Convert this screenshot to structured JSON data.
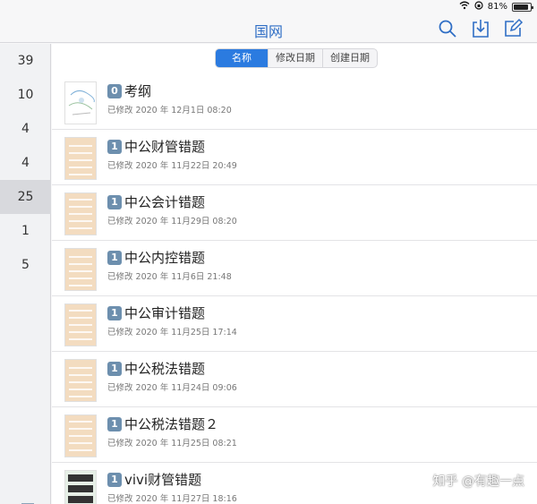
{
  "status_bar": {
    "battery": "81%",
    "battery_level": 0.81
  },
  "nav": {
    "title": "国网"
  },
  "sidebar": {
    "counts": [
      "39",
      "10",
      "4",
      "4",
      "25",
      "1",
      "5"
    ],
    "selected_index": 4
  },
  "sort": {
    "options": [
      "名称",
      "修改日期",
      "创建日期"
    ],
    "active": "名称"
  },
  "notes": [
    {
      "badge": "0",
      "title": "考纲",
      "subtitle": "已修改 2020 年 12月1日 08:20"
    },
    {
      "badge": "1",
      "title": "中公财管错题",
      "subtitle": "已修改 2020 年 11月22日 20:49"
    },
    {
      "badge": "1",
      "title": "中公会计错题",
      "subtitle": "已修改 2020 年 11月29日 08:20"
    },
    {
      "badge": "1",
      "title": "中公内控错题",
      "subtitle": "已修改 2020 年 11月6日 21:48"
    },
    {
      "badge": "1",
      "title": "中公审计错题",
      "subtitle": "已修改 2020 年 11月25日 17:14"
    },
    {
      "badge": "1",
      "title": "中公税法错题",
      "subtitle": "已修改 2020 年 11月24日 09:06"
    },
    {
      "badge": "1",
      "title": "中公税法错题２",
      "subtitle": "已修改 2020 年 11月25日 08:21"
    },
    {
      "badge": "1",
      "title": "vivi财管错题",
      "subtitle": "已修改 2020 年 11月27日 18:16"
    }
  ],
  "watermark": "知乎 @有趣一点",
  "colors": {
    "accent": "#2f6ec5",
    "segment_active": "#2b7be0"
  }
}
